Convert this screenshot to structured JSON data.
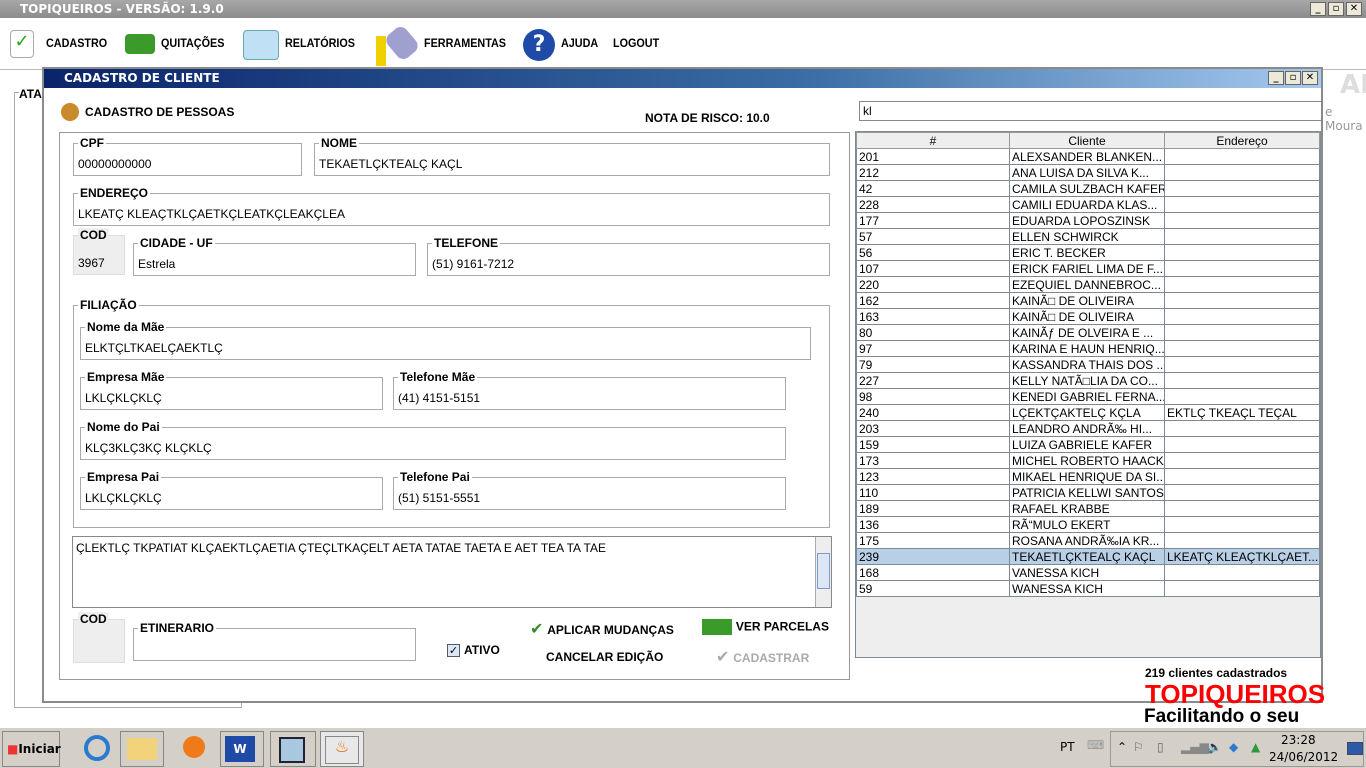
{
  "app": {
    "title": "TOPIQUEIROS - VERSÃO: 1.9.0",
    "win_min": "_",
    "win_max": "▫",
    "win_close": "✕"
  },
  "menu": [
    {
      "label": "CADASTRO",
      "icon": "checklist-icon"
    },
    {
      "label": "QUITAÇÕES",
      "icon": "money-icon"
    },
    {
      "label": "RELATÓRIOS",
      "icon": "notepad-icon"
    },
    {
      "label": "FERRAMENTAS",
      "icon": "tools-icon"
    },
    {
      "label": "AJUDA",
      "icon": "help-icon"
    },
    {
      "label": "LOGOUT"
    }
  ],
  "background": {
    "panel_label": "ATA",
    "right_text": "ALE",
    "right_text2": "e Moura",
    "logo": "TOPIQUEIROS",
    "slogan": "Facilitando o seu controle"
  },
  "dialog": {
    "title": "CADASTRO DE CLIENTE",
    "section": "CADASTRO DE PESSOAS",
    "risk": "NOTA DE RISCO: 10.0",
    "cpf": {
      "label": "CPF",
      "value": "00000000000"
    },
    "nome": {
      "label": "NOME",
      "value": "TEKAETLÇKTEALÇ KAÇL"
    },
    "endereco": {
      "label": "ENDEREÇO",
      "value": "LKEATÇ KLEAÇTKLÇAETKÇLEATKÇLEAKÇLEA"
    },
    "cod": {
      "label": "COD",
      "value": "3967"
    },
    "cidade": {
      "label": "CIDADE - UF",
      "value": "Estrela"
    },
    "telefone": {
      "label": "TELEFONE",
      "value": "(51) 9161-7212"
    },
    "filiacao": "FILIAÇÃO",
    "mae": {
      "label": "Nome da Mãe",
      "value": "ELKTÇLTKAELÇAEKTLÇ"
    },
    "empresa_mae": {
      "label": "Empresa Mãe",
      "value": "LKLÇKLÇKLÇ"
    },
    "tel_mae": {
      "label": "Telefone Mãe",
      "value": "(41) 4151-5151"
    },
    "pai": {
      "label": "Nome do Pai",
      "value": "KLÇ3KLÇ3KÇ KLÇKLÇ"
    },
    "empresa_pai": {
      "label": "Empresa Pai",
      "value": "LKLÇKLÇKLÇ"
    },
    "tel_pai": {
      "label": "Telefone Pai",
      "value": "(51) 5151-5551"
    },
    "obs": "ÇLEKTLÇ TKPATIAT KLÇAEKTLÇAETIA ÇTEÇLTKAÇELT AETA TATAE TAETA E AET TEA TA TAE",
    "cod2": {
      "label": "COD"
    },
    "etinerario": {
      "label": "ETINERARIO",
      "value": ""
    },
    "ativo": {
      "label": "ATIVO",
      "checked": true
    },
    "aplicar": "APLICAR MUDANÇAS",
    "ver_parcelas": "VER PARCELAS",
    "cancelar": "CANCELAR EDIÇÃO",
    "cadastrar": "CADASTRAR",
    "search": "kl",
    "columns": [
      "#",
      "Cliente",
      "Endereço"
    ],
    "rows": [
      [
        "201",
        "ALEXSANDER  BLANKEN...",
        ""
      ],
      [
        "212",
        "ANA  LUISA  DA  SILVA  K...",
        ""
      ],
      [
        "42",
        "CAMILA SULZBACH KAFER",
        ""
      ],
      [
        "228",
        "CAMILI  EDUARDA  KLAS...",
        ""
      ],
      [
        "177",
        "EDUARDA LOPOSZINSK",
        ""
      ],
      [
        "57",
        "ELLEN SCHWIRCK",
        ""
      ],
      [
        "56",
        "ERIC T. BECKER",
        ""
      ],
      [
        "107",
        "ERICK FARIEL LIMA DE F...",
        ""
      ],
      [
        "220",
        "EZEQUIEL DANNEBROC...",
        ""
      ],
      [
        "162",
        "KAINÃ□ DE OLIVEIRA",
        ""
      ],
      [
        "163",
        "KAINÃ□ DE OLIVEIRA",
        ""
      ],
      [
        "80",
        "KAINÃƒ DE OLVEIRA   E   ...",
        ""
      ],
      [
        "97",
        "KARINA E HAUN HENRIQ...",
        ""
      ],
      [
        "79",
        "KASSANDRA THAIS DOS ...",
        ""
      ],
      [
        "227",
        "KELLY  NATÃ□LIA DA CO...",
        ""
      ],
      [
        "98",
        "KENEDI GABRIEL FERNA...",
        ""
      ],
      [
        "240",
        "LÇEKTÇAKTELÇ KÇLA",
        "EKTLÇ TKEAÇL TEÇAL"
      ],
      [
        "203",
        "LEANDRO   ANDRÃ‰   HI...",
        ""
      ],
      [
        "159",
        "LUIZA GABRIELE KAFER",
        ""
      ],
      [
        "173",
        "MICHEL ROBERTO HAACK",
        ""
      ],
      [
        "123",
        "MIKAEL HENRIQUE DA SI...",
        ""
      ],
      [
        "110",
        "PATRICIA KELLWI SANTOS",
        ""
      ],
      [
        "189",
        "RAFAEL KRABBE",
        ""
      ],
      [
        "136",
        "RÃ“MULO EKERT",
        ""
      ],
      [
        "175",
        "ROSANA ANDRÃ‰IA KR...",
        ""
      ],
      [
        "239",
        "TEKAETLÇKTEALÇ KAÇL",
        "LKEATÇ KLEAÇTKLÇAET..."
      ],
      [
        "168",
        "VANESSA KICH",
        ""
      ],
      [
        "59",
        "WANESSA KICH",
        ""
      ]
    ],
    "selected_row": "239",
    "count": "219 clientes cadastrados"
  },
  "taskbar": {
    "start": "Iniciar",
    "lang": "PT",
    "time": "23:28",
    "date": "24/06/2012"
  }
}
